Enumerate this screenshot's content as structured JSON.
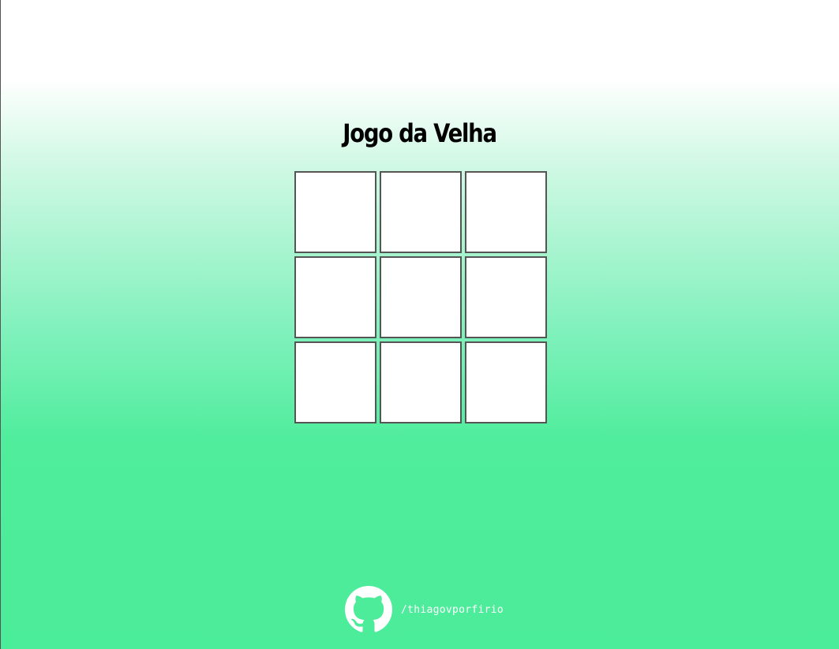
{
  "page": {
    "title": "Jogo da Velha"
  },
  "board": {
    "rows": 3,
    "cols": 3,
    "cells": [
      "",
      "",
      "",
      "",
      "",
      "",
      "",
      "",
      ""
    ]
  },
  "footer": {
    "icon": "github-icon",
    "handle": "/thiagovporfirio"
  },
  "colors": {
    "gradient_top": "#ffffff",
    "gradient_bottom": "#4bec9a",
    "cell_fill": "#ffffff",
    "cell_border": "#555555",
    "footer_text": "#ffffff"
  }
}
